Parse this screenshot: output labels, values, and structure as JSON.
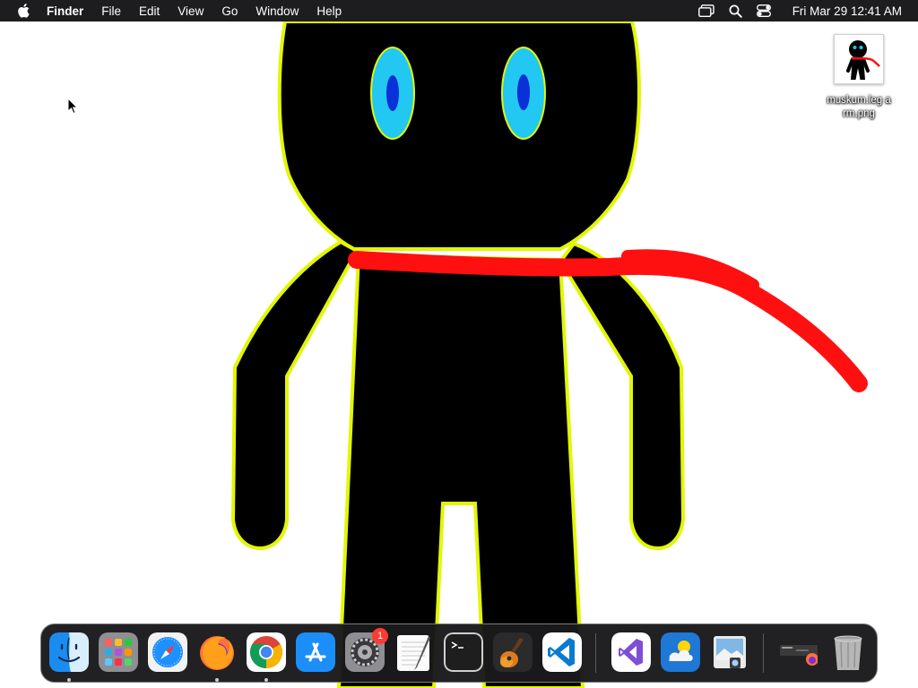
{
  "menubar": {
    "app_name": "Finder",
    "menus": [
      "File",
      "Edit",
      "View",
      "Go",
      "Window",
      "Help"
    ],
    "clock": "Fri Mar 29  12:41 AM"
  },
  "desktop": {
    "file_name": "muskum.leg arm.png"
  },
  "dock": {
    "apps": [
      {
        "name": "Finder",
        "icon": "finder-icon",
        "running": true
      },
      {
        "name": "Launchpad",
        "icon": "launchpad-icon",
        "running": false
      },
      {
        "name": "Safari",
        "icon": "safari-icon",
        "running": false
      },
      {
        "name": "Firefox",
        "icon": "firefox-icon",
        "running": true
      },
      {
        "name": "Google Chrome",
        "icon": "chrome-icon",
        "running": true
      },
      {
        "name": "App Store",
        "icon": "app-store-icon",
        "running": false
      },
      {
        "name": "System Settings",
        "icon": "system-settings-icon",
        "running": false,
        "badge": "1"
      },
      {
        "name": "TextEdit",
        "icon": "textedit-icon",
        "running": false
      },
      {
        "name": "Terminal",
        "icon": "terminal-icon",
        "running": false
      },
      {
        "name": "GarageBand",
        "icon": "garageband-icon",
        "running": false
      },
      {
        "name": "Visual Studio Code",
        "icon": "vscode-icon",
        "running": false
      },
      {
        "name": "Visual Studio",
        "icon": "visual-studio-icon",
        "running": false
      },
      {
        "name": "Weather",
        "icon": "weather-icon",
        "running": false
      },
      {
        "name": "Preview",
        "icon": "preview-icon",
        "running": false
      },
      {
        "name": "Downloads",
        "icon": "downloads-stack-icon",
        "running": false
      },
      {
        "name": "Trash",
        "icon": "trash-icon",
        "running": false
      }
    ]
  },
  "colors": {
    "menubar_bg": "#1d1d1f",
    "figure": "#000000",
    "outline": "#e2f700",
    "eyes": "#22c7f2",
    "pupils": "#0a30d8",
    "scarf": "#ff1010"
  }
}
